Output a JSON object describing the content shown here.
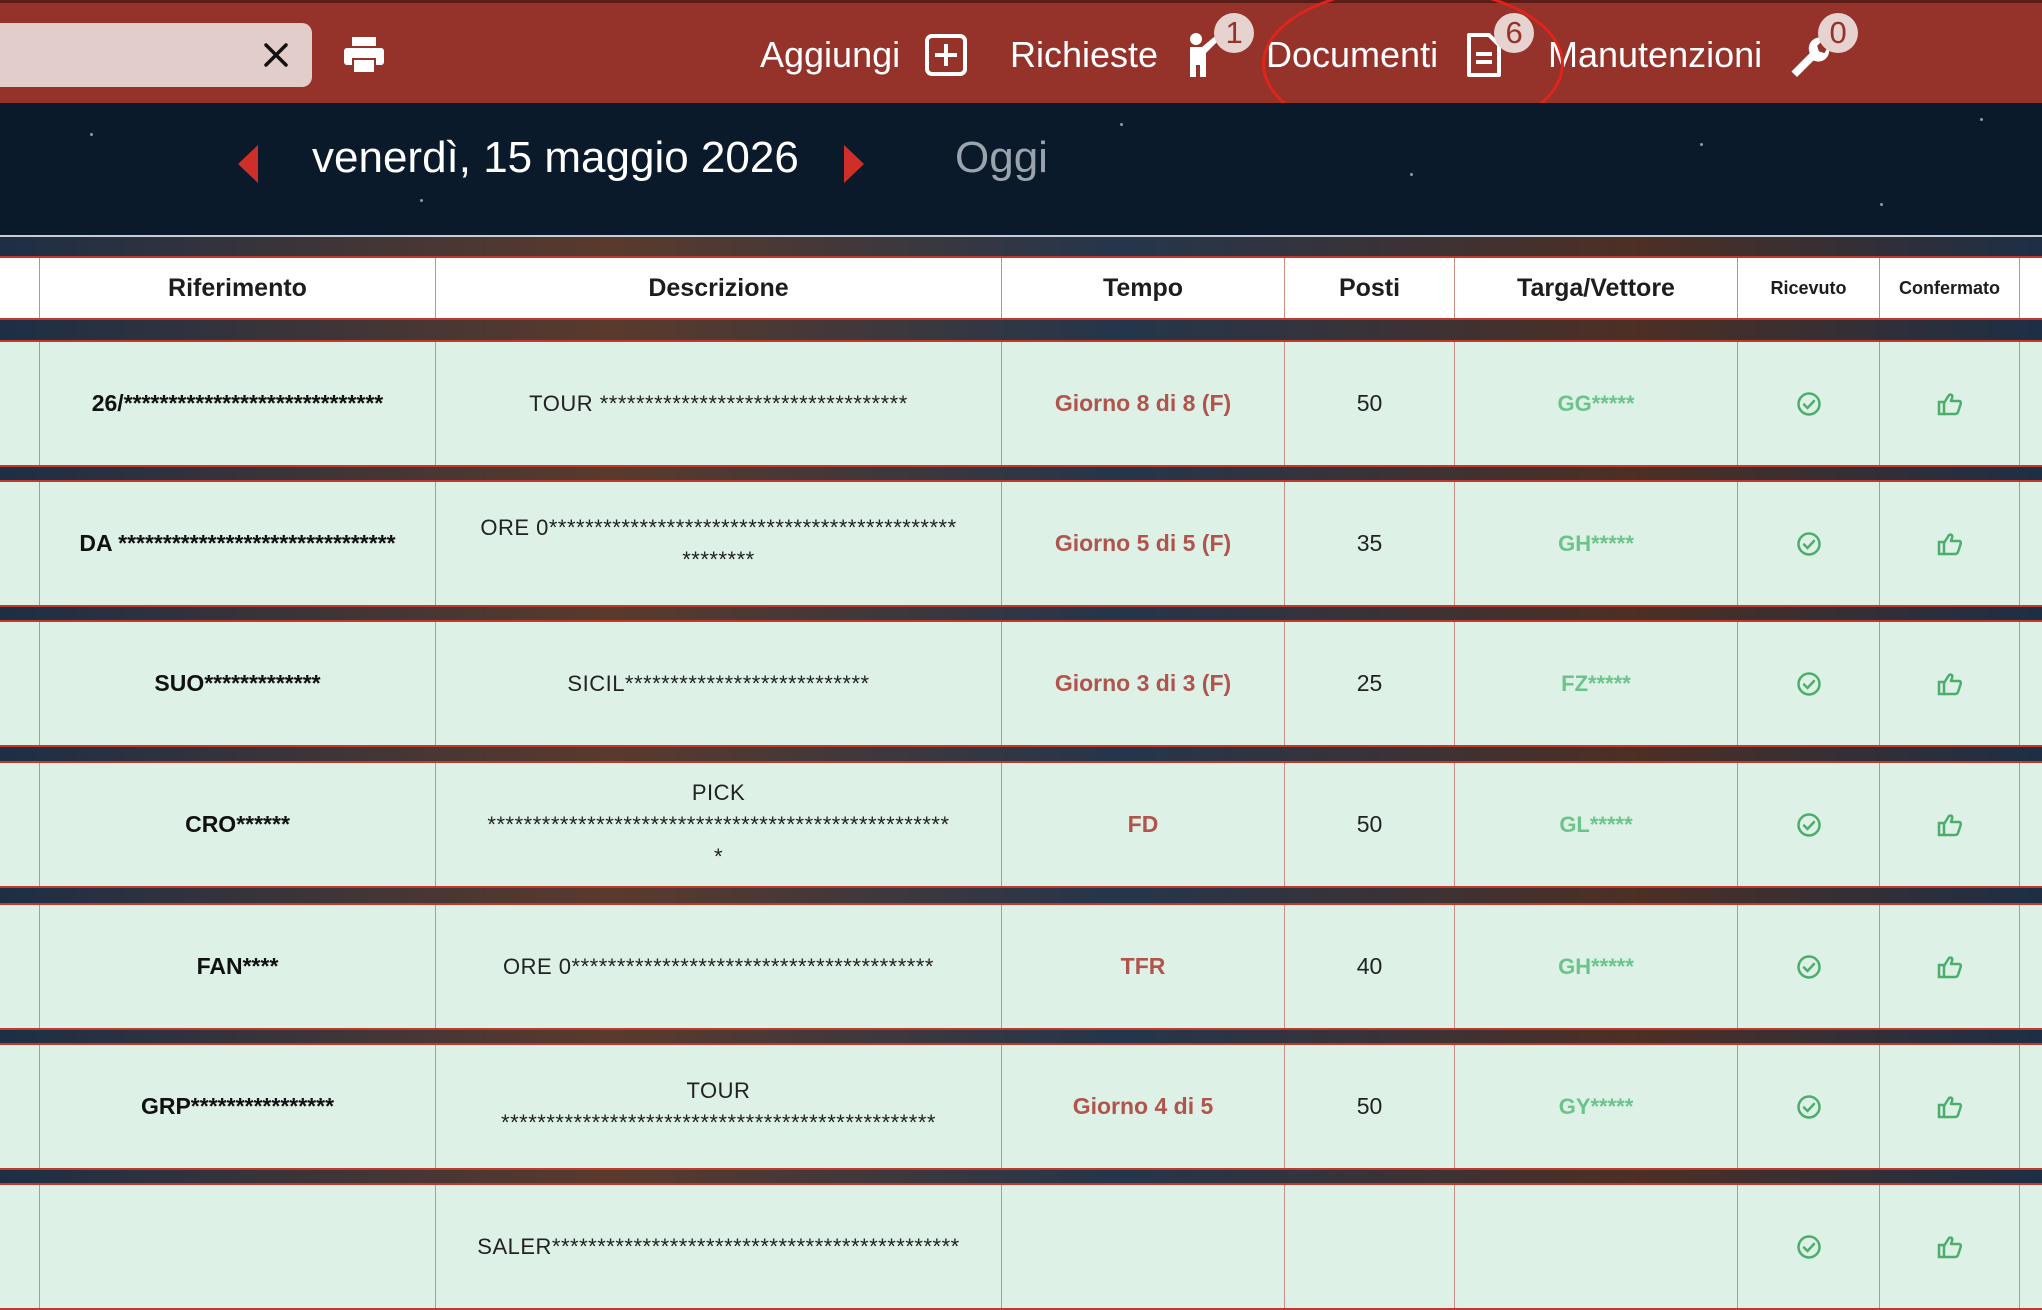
{
  "topbar": {
    "nav": [
      {
        "label": "Aggiungi"
      },
      {
        "label": "Richieste",
        "badge": "1"
      },
      {
        "label": "Documenti",
        "badge": "6"
      },
      {
        "label": "Manutenzioni",
        "badge": "0"
      }
    ]
  },
  "dateband": {
    "date": "venerdì, 15 maggio 2026",
    "today": "Oggi"
  },
  "table": {
    "headers": [
      "Riferimento",
      "Descrizione",
      "Tempo",
      "Posti",
      "Targa/Vettore",
      "Ricevuto",
      "Confermato"
    ],
    "rows": [
      {
        "ref": "26/*****************************",
        "desc": "TOUR **********************************",
        "tempo": "Giorno 8 di 8 (F)",
        "posti": "50",
        "targa": "GG*****"
      },
      {
        "ref": "DA *******************************",
        "desc": "ORE 0*********************************************\n********",
        "tempo": "Giorno 5 di 5 (F)",
        "posti": "35",
        "targa": "GH*****"
      },
      {
        "ref": "SUO*************",
        "desc": "SICIL***************************",
        "tempo": "Giorno 3 di 3 (F)",
        "posti": "25",
        "targa": "FZ*****"
      },
      {
        "ref": "CRO******",
        "desc": "PICK\n***************************************************\n*",
        "tempo": "FD",
        "posti": "50",
        "targa": "GL*****"
      },
      {
        "ref": "FAN****",
        "desc": "ORE 0****************************************",
        "tempo": "TFR",
        "posti": "40",
        "targa": "GH*****"
      },
      {
        "ref": "GRP****************",
        "desc": "TOUR\n************************************************",
        "tempo": "Giorno 4 di 5",
        "posti": "50",
        "targa": "GY*****"
      },
      {
        "ref": "",
        "desc": "SALER*********************************************",
        "tempo": "",
        "posti": "",
        "targa": ""
      }
    ]
  },
  "colors": {
    "topbar": "#95322a",
    "row_bg": "#ddf1e7",
    "tempo_text": "#b0544c",
    "targa_text": "#6cc48a",
    "accent_red": "#cf2f28"
  },
  "icons": {
    "search_close": "close-icon",
    "print": "printer-icon",
    "aggiungi": "add-square-icon",
    "richieste": "person-raising-hand-icon",
    "documenti": "document-icon",
    "manutenzioni": "wrench-icon",
    "ricevuto": "check-circle-icon",
    "confermato": "thumbs-up-icon"
  }
}
